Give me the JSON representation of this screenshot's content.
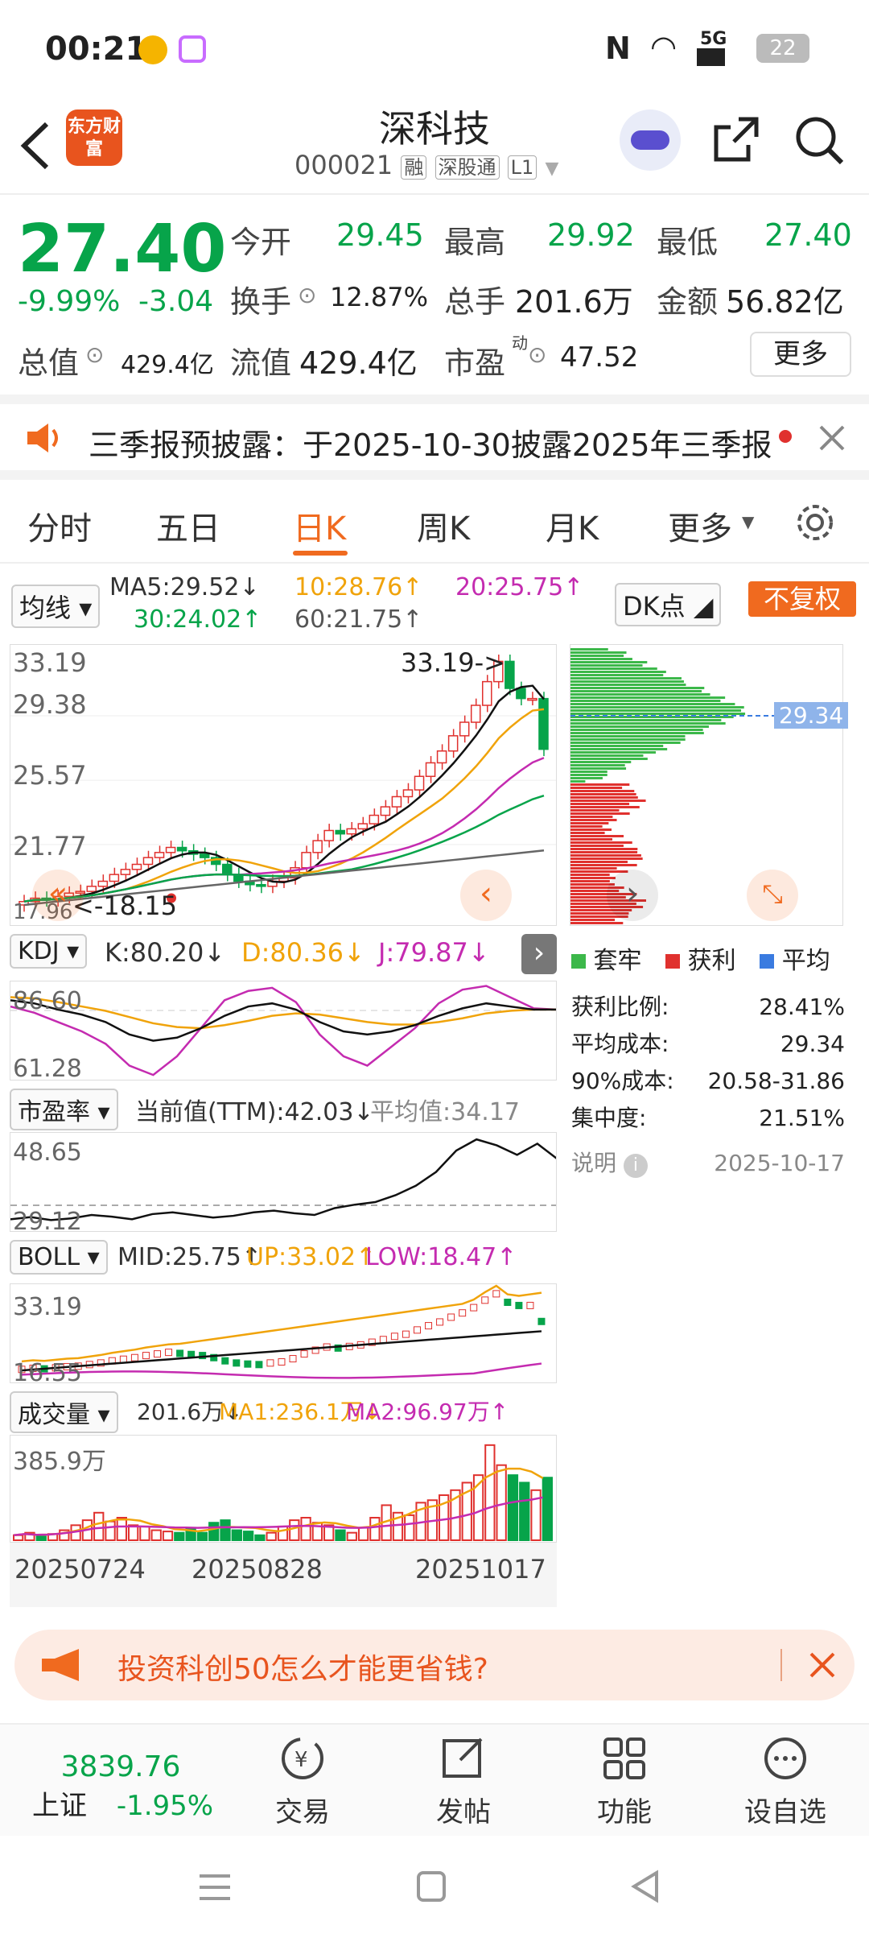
{
  "status": {
    "time": "00:21",
    "battery": "22",
    "network": "5G"
  },
  "header": {
    "title": "深科技",
    "code": "000021",
    "tags": [
      "融",
      "深股通",
      "L1"
    ],
    "brand": "东方财富"
  },
  "quote": {
    "price": "27.40",
    "pct": "-9.99%",
    "chg": "-3.04",
    "row1": [
      {
        "label": "今开",
        "value": "29.45"
      },
      {
        "label": "最高",
        "value": "29.92"
      },
      {
        "label": "最低",
        "value": "27.40"
      }
    ],
    "turnover_label": "换手",
    "turnover": "12.87%",
    "volume_label": "总手",
    "volume": "201.6万",
    "amount_label": "金额",
    "amount": "56.82亿",
    "mcap_label": "总值",
    "mcap": "429.4亿",
    "float_label": "流值",
    "float": "429.4亿",
    "pe_label": "市盈",
    "pe_sup": "动",
    "pe": "47.52",
    "more": "更多"
  },
  "notice": {
    "text": "三季报预披露：于2025-10-30披露2025年三季报"
  },
  "tabs": [
    "分时",
    "五日",
    "日K",
    "周K",
    "月K",
    "更多"
  ],
  "active_tab": "日K",
  "ma": {
    "selector": "均线",
    "ma5": "MA5:29.52↓",
    "ma10": "10:28.76↑",
    "ma20": "20:25.75↑",
    "ma30": "30:24.02↑",
    "ma60": "60:21.75↑",
    "dk": "DK点",
    "fuquan": "不复权"
  },
  "kline": {
    "y_labels": [
      "33.19",
      "29.38",
      "25.57",
      "21.77",
      "17.96"
    ],
    "max_label": "33.19->",
    "min_label": "<-18.15",
    "closes": [
      18.4,
      18.6,
      18.5,
      18.7,
      18.9,
      19.0,
      19.3,
      19.6,
      20.0,
      20.3,
      20.6,
      21.0,
      21.3,
      21.6,
      21.4,
      21.2,
      21.0,
      20.6,
      20.0,
      19.6,
      19.4,
      19.3,
      19.6,
      19.8,
      20.4,
      21.3,
      22.0,
      22.6,
      22.4,
      22.7,
      23.0,
      23.5,
      24.0,
      24.6,
      25.0,
      25.8,
      26.6,
      27.3,
      28.2,
      29.0,
      30.0,
      31.4,
      32.6,
      31.0,
      30.4,
      30.4,
      27.4
    ],
    "ymin": 17.96,
    "ymax": 33.19
  },
  "chips": {
    "avg_label": "29.34",
    "legend": [
      "套牢",
      "获利",
      "平均"
    ],
    "stats": [
      {
        "k": "获利比例:",
        "v": "28.41%"
      },
      {
        "k": "平均成本:",
        "v": "29.34"
      },
      {
        "k": "90%成本:",
        "v": "20.58-31.86"
      },
      {
        "k": "集中度:",
        "v": "21.51%"
      }
    ],
    "note": "说明",
    "date": "2025-10-17"
  },
  "kdj": {
    "selector": "KDJ",
    "k": "K:80.20↓",
    "d": "D:80.36↓",
    "j": "J:79.87↓",
    "y_top": "86.60",
    "y_bot": "61.28"
  },
  "pe": {
    "selector": "市盈率",
    "current": "当前值(TTM):42.03↓",
    "avg": "平均值:34.17",
    "y_top": "48.65",
    "y_bot": "29.12"
  },
  "boll": {
    "selector": "BOLL",
    "mid": "MID:25.75↑",
    "up": "UP:33.02↑",
    "low": "LOW:18.47↑",
    "y_top": "33.19",
    "y_bot": "16.55"
  },
  "vol": {
    "selector": "成交量",
    "value": "201.6万↓",
    "ma1": "MA1:236.1万↓",
    "ma2": "MA2:96.97万↑",
    "y_top": "385.9万",
    "dates": [
      "20250724",
      "20250828",
      "20251017"
    ]
  },
  "ad": {
    "text": "投资科创50怎么才能更省钱?"
  },
  "bottom": {
    "index_value": "3839.76",
    "index_name": "上证",
    "index_pct": "-1.95%",
    "items": [
      "交易",
      "发帖",
      "功能",
      "设自选"
    ]
  }
}
